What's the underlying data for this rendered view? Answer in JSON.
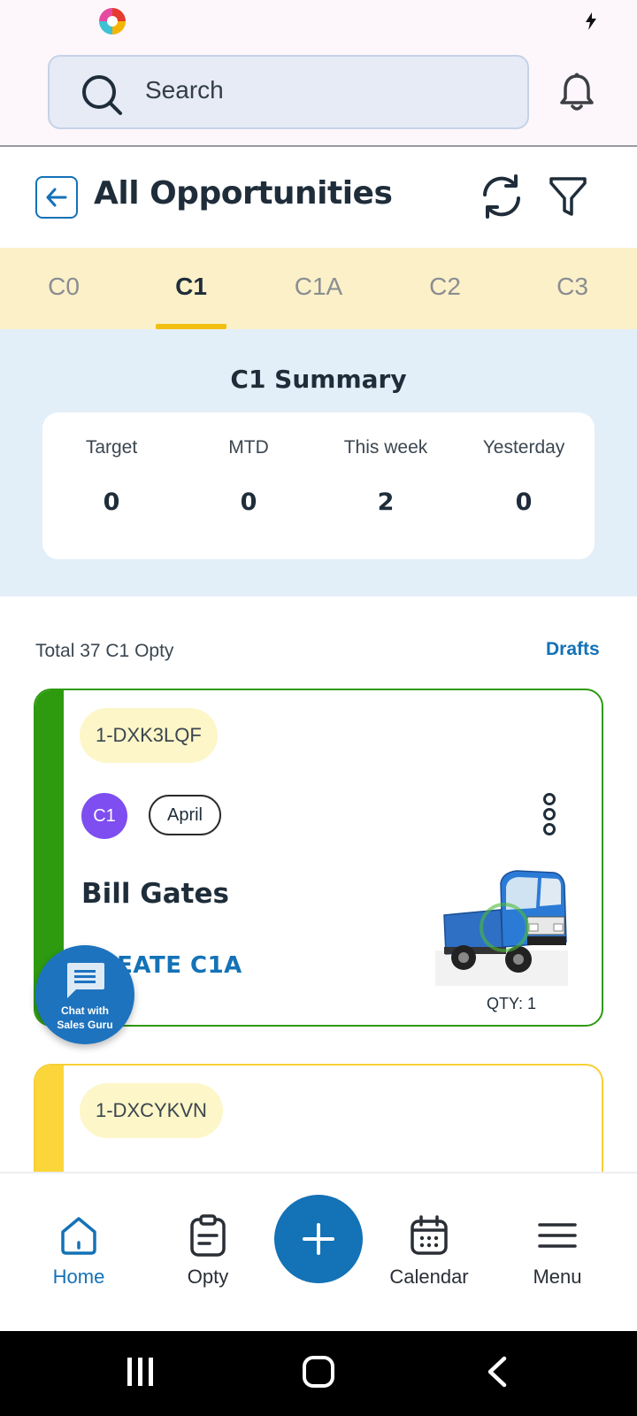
{
  "search": {
    "placeholder": "Search"
  },
  "header": {
    "title": "All Opportunities"
  },
  "tabs": [
    {
      "label": "C0",
      "active": false
    },
    {
      "label": "C1",
      "active": true
    },
    {
      "label": "C1A",
      "active": false
    },
    {
      "label": "C2",
      "active": false
    },
    {
      "label": "C3",
      "active": false
    }
  ],
  "summary": {
    "title": "C1 Summary",
    "stats": [
      {
        "label": "Target",
        "value": "0"
      },
      {
        "label": "MTD",
        "value": "0"
      },
      {
        "label": "This week",
        "value": "2"
      },
      {
        "label": "Yesterday",
        "value": "0"
      }
    ]
  },
  "list": {
    "total_text": "Total 37 C1 Opty",
    "drafts_label": "Drafts"
  },
  "cards": [
    {
      "opty_id": "1-DXK3LQF",
      "stage": "C1",
      "month": "April",
      "customer": "Bill Gates",
      "action": "CREATE C1A",
      "qty": "QTY: 1",
      "status_color": "#2e9a10"
    },
    {
      "opty_id": "1-DXCYKVN",
      "status_color": "#fbd63a"
    }
  ],
  "chat": {
    "line1": "Chat with",
    "line2": "Sales Guru"
  },
  "nav": {
    "home": "Home",
    "opty": "Opty",
    "calendar": "Calendar",
    "menu": "Menu"
  },
  "colors": {
    "accent": "#1472b6",
    "tab_bg": "#fbf0c8",
    "summary_bg": "#e3eff8",
    "tab_indicator": "#f1bf11"
  }
}
